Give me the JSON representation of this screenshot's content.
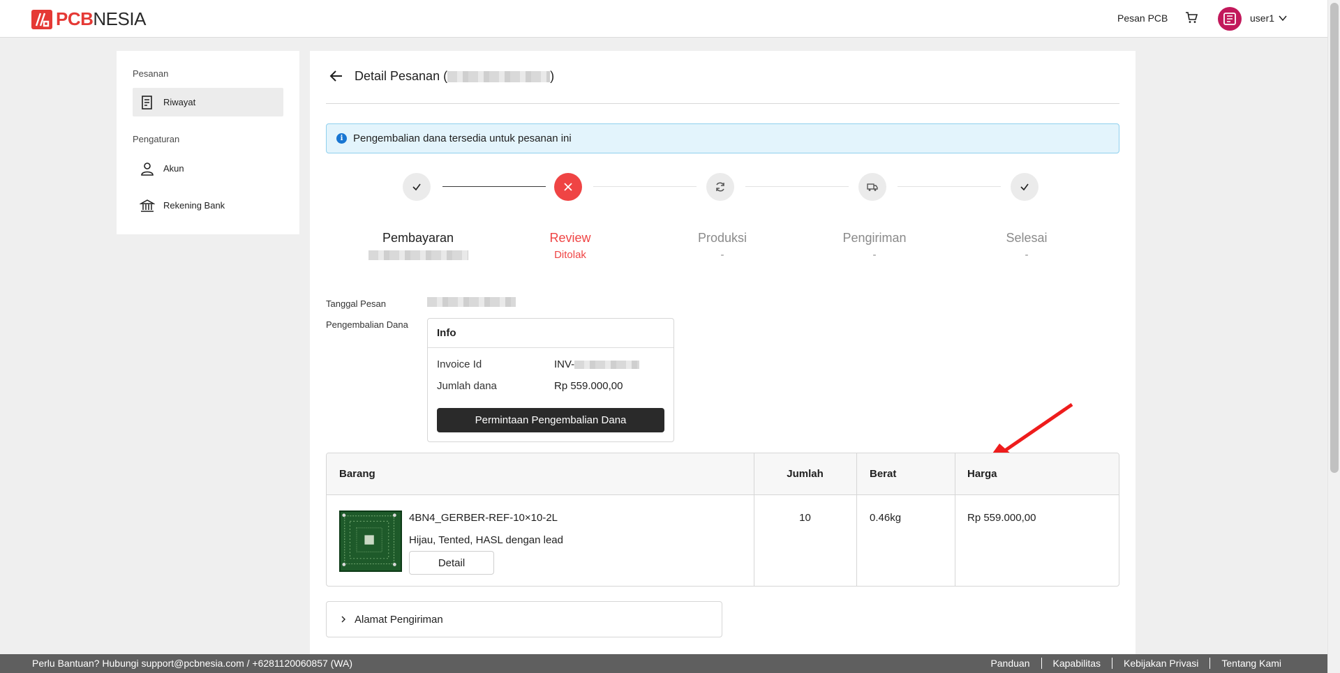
{
  "header": {
    "logo_pcb": "PCB",
    "logo_nesia": "NESIA",
    "nav_order_pcb": "Pesan PCB",
    "cart_icon": "cart-icon",
    "user_name": "user1"
  },
  "sidebar": {
    "section_orders": "Pesanan",
    "item_history": "Riwayat",
    "section_settings": "Pengaturan",
    "item_account": "Akun",
    "item_bank": "Rekening Bank"
  },
  "page": {
    "title_prefix": "Detail Pesanan (",
    "title_suffix": ")",
    "banner_text": "Pengembalian dana tersedia untuk pesanan ini"
  },
  "stepper": [
    {
      "label": "Pembayaran",
      "sub": "",
      "state": "done"
    },
    {
      "label": "Review",
      "sub": "Ditolak",
      "state": "rejected"
    },
    {
      "label": "Produksi",
      "sub": "-",
      "state": "pending"
    },
    {
      "label": "Pengiriman",
      "sub": "-",
      "state": "pending"
    },
    {
      "label": "Selesai",
      "sub": "-",
      "state": "pending"
    }
  ],
  "details": {
    "order_date_label": "Tanggal Pesan",
    "refund_label": "Pengembalian Dana",
    "refund_box": {
      "header": "Info",
      "invoice_label": "Invoice Id",
      "invoice_prefix": "INV-",
      "amount_label": "Jumlah dana",
      "amount_value": "Rp 559.000,00",
      "button_label": "Permintaan Pengembalian Dana"
    }
  },
  "table": {
    "headers": [
      "Barang",
      "Jumlah",
      "Berat",
      "Harga"
    ],
    "rows": [
      {
        "name": "4BN4_GERBER-REF-10×10-2L",
        "description": "Hijau, Tented, HASL dengan lead",
        "detail_button": "Detail",
        "quantity": "10",
        "weight": "0.46kg",
        "price": "Rp 559.000,00"
      }
    ]
  },
  "shipping": {
    "label": "Alamat Pengiriman"
  },
  "footer": {
    "help_text": "Perlu Bantuan? Hubungi  support@pcbnesia.com  /  +6281120060857 (WA)",
    "links": [
      "Panduan",
      "Kapabilitas",
      "Kebijakan Privasi",
      "Tentang Kami"
    ]
  },
  "colors": {
    "accent_red": "#ef4444",
    "banner_bg": "#e3f4fc",
    "button_dark": "#2a2a2a",
    "footer_bg": "#5f5f5f"
  }
}
